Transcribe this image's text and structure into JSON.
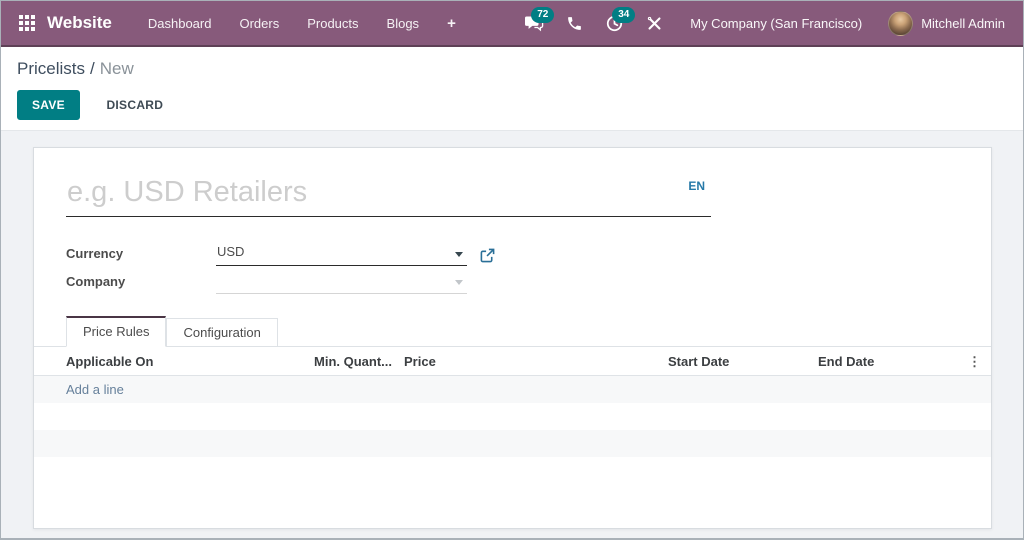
{
  "navbar": {
    "app_name": "Website",
    "menu_items": [
      "Dashboard",
      "Orders",
      "Products",
      "Blogs"
    ],
    "plus_label": "+",
    "messages_badge": "72",
    "activities_badge": "34",
    "company": "My Company (San Francisco)",
    "user": "Mitchell Admin",
    "bar_color": "#875A7B",
    "badge_color": "#017E84"
  },
  "breadcrumb": {
    "parent": "Pricelists",
    "separator": "/",
    "current": "New"
  },
  "actions": {
    "save": "SAVE",
    "discard": "DISCARD",
    "save_color": "#017E84"
  },
  "form": {
    "title_placeholder": "e.g. USD Retailers",
    "language_badge": "EN",
    "currency_label": "Currency",
    "currency_value": "USD",
    "company_label": "Company",
    "company_value": ""
  },
  "tabs": {
    "price_rules": "Price Rules",
    "configuration": "Configuration"
  },
  "table": {
    "headers": [
      "Applicable On",
      "Min. Quant...",
      "Price",
      "Start Date",
      "End Date"
    ],
    "options_glyph": "⋮",
    "add_line": "Add a line"
  },
  "icons": {
    "apps_grid": "grid-3x3",
    "messages": "chat-bubbles",
    "phone": "phone-receiver",
    "activities": "clock",
    "tools": "crossed-wrench",
    "external_link": "arrow-out-of-box",
    "caret": "chevron-down",
    "column_options": "vertical-ellipsis"
  }
}
